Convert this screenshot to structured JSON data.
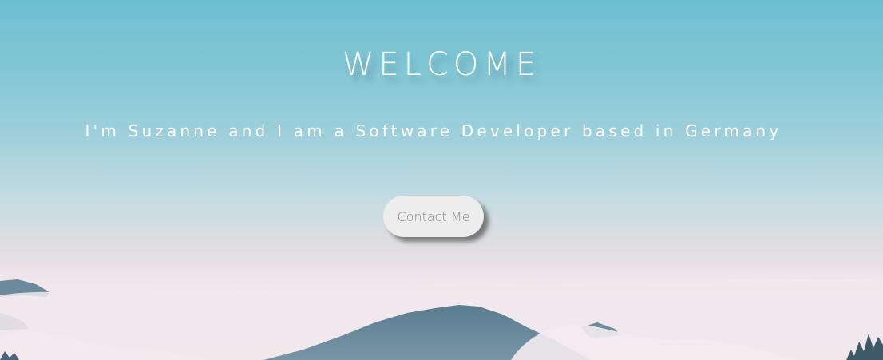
{
  "hero": {
    "title": "WELCOME",
    "subtitle": "I'm Suzanne and I am a Software Developer based in Germany",
    "contact_button_label": "Contact Me"
  },
  "colors": {
    "sky_top": "#6dbfd2",
    "haze": "#efe3e8",
    "mountain": "#4f7487",
    "button_bg": "#eeeded",
    "button_text": "#8a8a8a",
    "text": "#ffffff"
  }
}
